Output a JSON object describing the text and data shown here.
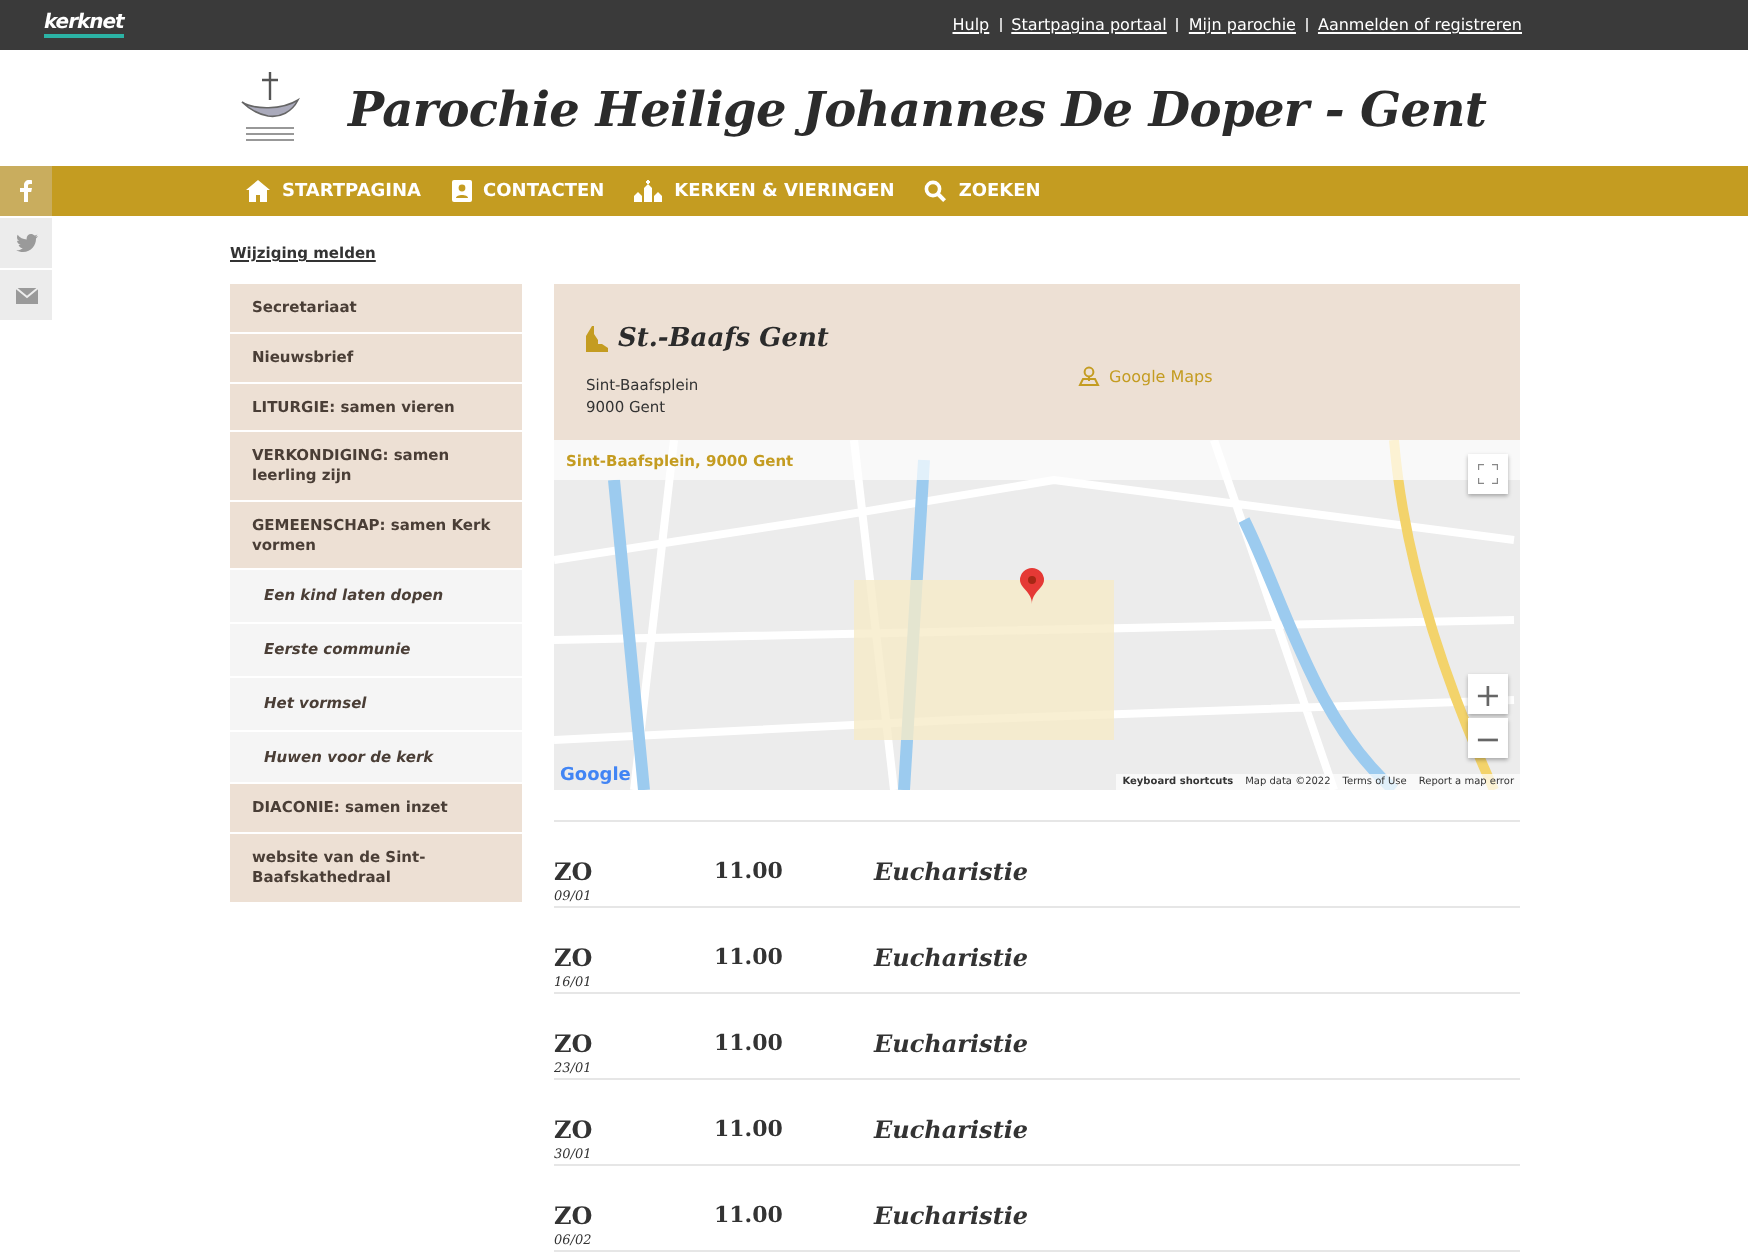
{
  "topbar": {
    "logo": "kerknet",
    "links": [
      "Hulp",
      "Startpagina portaal",
      "Mijn parochie",
      "Aanmelden of registreren"
    ]
  },
  "header": {
    "title": "Parochie Heilige Johannes De Doper - Gent"
  },
  "nav": [
    {
      "label": "STARTPAGINA",
      "kind": "home"
    },
    {
      "label": "CONTACTEN",
      "kind": "contact"
    },
    {
      "label": "KERKEN & VIERINGEN",
      "kind": "churches"
    },
    {
      "label": "ZOEKEN",
      "kind": "search"
    }
  ],
  "social": [
    {
      "kind": "facebook",
      "selected": true
    },
    {
      "kind": "twitter",
      "selected": false
    },
    {
      "kind": "mail",
      "selected": false
    }
  ],
  "report_link": "Wijziging melden",
  "sidebar": [
    {
      "label": "Secretariaat",
      "kind": "section"
    },
    {
      "label": "Nieuwsbrief",
      "kind": "section"
    },
    {
      "label": "LITURGIE: samen vieren",
      "kind": "section"
    },
    {
      "label": "VERKONDIGING: samen leerling zijn",
      "kind": "section"
    },
    {
      "label": "GEMEENSCHAP: samen Kerk vormen",
      "kind": "section"
    },
    {
      "label": "Een kind laten dopen",
      "kind": "sub"
    },
    {
      "label": "Eerste communie",
      "kind": "sub"
    },
    {
      "label": "Het vormsel",
      "kind": "sub"
    },
    {
      "label": "Huwen voor de kerk",
      "kind": "sub"
    },
    {
      "label": "DIACONIE: samen inzet",
      "kind": "section"
    },
    {
      "label": "website van de Sint-Baafskathedraal",
      "kind": "section"
    }
  ],
  "church": {
    "name": "St.-Baafs Gent",
    "address": [
      "Sint-Baafsplein",
      "9000 Gent"
    ],
    "maps_link": "Google Maps"
  },
  "map": {
    "place_label": "Sint-Baafsplein, 9000 Gent",
    "zoom_in": "+",
    "zoom_out": "−",
    "logo": "Google",
    "footer": [
      "Keyboard shortcuts",
      "Map data ©2022",
      "Terms of Use",
      "Report a map error"
    ]
  },
  "services": [
    {
      "day": "ZO",
      "date": "09/01",
      "time": "11.00",
      "title": "Eucharistie"
    },
    {
      "day": "ZO",
      "date": "16/01",
      "time": "11.00",
      "title": "Eucharistie"
    },
    {
      "day": "ZO",
      "date": "23/01",
      "time": "11.00",
      "title": "Eucharistie"
    },
    {
      "day": "ZO",
      "date": "30/01",
      "time": "11.00",
      "title": "Eucharistie"
    },
    {
      "day": "ZO",
      "date": "06/02",
      "time": "11.00",
      "title": "Eucharistie"
    }
  ]
}
